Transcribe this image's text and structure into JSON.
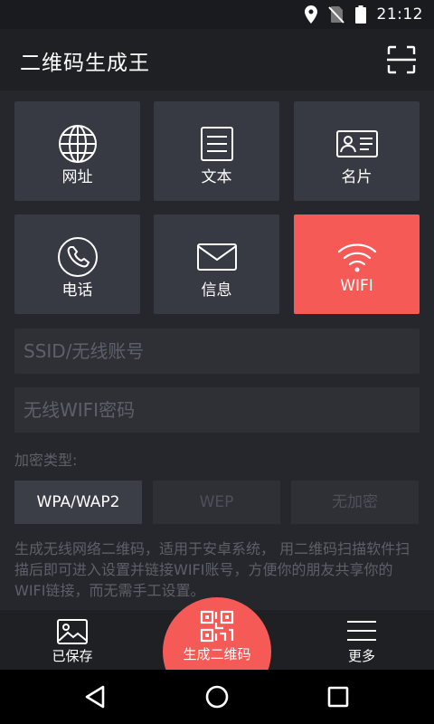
{
  "status_bar": {
    "time": "21:12",
    "icons": [
      "location-icon",
      "no-sim-icon",
      "battery-icon"
    ]
  },
  "app_bar": {
    "title": "二维码生成王",
    "scan_icon": "scan-icon"
  },
  "types": [
    {
      "label": "网址",
      "icon": "globe-icon"
    },
    {
      "label": "文本",
      "icon": "text-icon"
    },
    {
      "label": "名片",
      "icon": "contact-card-icon"
    },
    {
      "label": "电话",
      "icon": "phone-icon"
    },
    {
      "label": "信息",
      "icon": "mail-icon"
    },
    {
      "label": "WIFI",
      "icon": "wifi-icon",
      "selected": true
    }
  ],
  "form": {
    "ssid_placeholder": "SSID/无线账号",
    "password_placeholder": "无线WIFI密码",
    "encryption_label": "加密类型:",
    "encryption_options": [
      "WPA/WAP2",
      "WEP",
      "无加密"
    ],
    "encryption_selected": "WPA/WAP2",
    "description": "生成无线网络二维码，适用于安卓系统， 用二维码扫描软件扫描后即可进入设置并链接WIFI账号，方便你的朋友共享你的WIFI链接，而无需手工设置。"
  },
  "bottom_nav": {
    "saved": "已保存",
    "generate": "生成二维码",
    "more": "更多"
  },
  "colors": {
    "accent": "#f55a57",
    "background": "#26272c",
    "tile": "#373943",
    "bar": "#1f2024"
  }
}
